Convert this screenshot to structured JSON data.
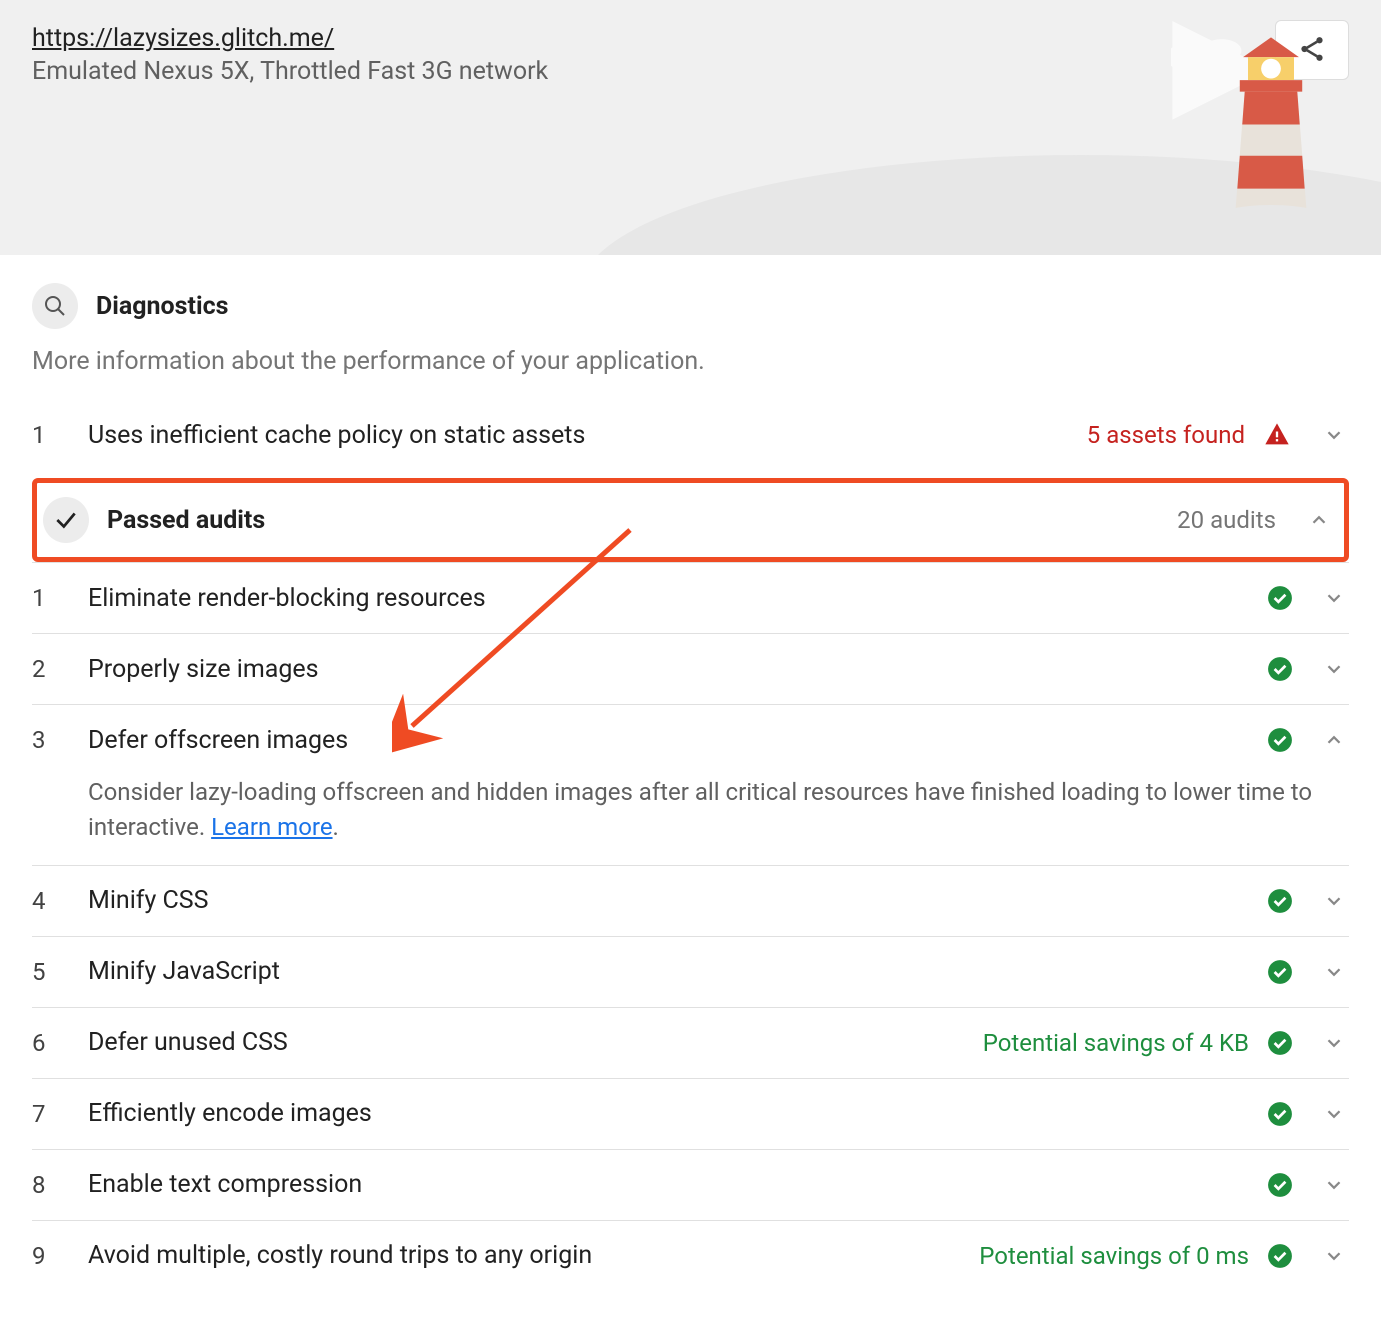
{
  "header": {
    "url": "https://lazysizes.glitch.me/",
    "subtitle": "Emulated Nexus 5X, Throttled Fast 3G network"
  },
  "diagnostics": {
    "title": "Diagnostics",
    "description": "More information about the performance of your application.",
    "items": [
      {
        "num": "1",
        "title": "Uses inefficient cache policy on static assets",
        "note": "5 assets found",
        "note_class": "red",
        "status": "warn",
        "expanded": false
      }
    ]
  },
  "passed": {
    "title": "Passed audits",
    "count": "20 audits",
    "items": [
      {
        "num": "1",
        "title": "Eliminate render-blocking resources",
        "note": "",
        "expanded": false
      },
      {
        "num": "2",
        "title": "Properly size images",
        "note": "",
        "expanded": false
      },
      {
        "num": "3",
        "title": "Defer offscreen images",
        "note": "",
        "expanded": true,
        "desc": "Consider lazy-loading offscreen and hidden images after all critical resources have finished loading to lower time to interactive. ",
        "learn_more": "Learn more"
      },
      {
        "num": "4",
        "title": "Minify CSS",
        "note": "",
        "expanded": false
      },
      {
        "num": "5",
        "title": "Minify JavaScript",
        "note": "",
        "expanded": false
      },
      {
        "num": "6",
        "title": "Defer unused CSS",
        "note": "Potential savings of 4 KB",
        "expanded": false
      },
      {
        "num": "7",
        "title": "Efficiently encode images",
        "note": "",
        "expanded": false
      },
      {
        "num": "8",
        "title": "Enable text compression",
        "note": "",
        "expanded": false
      },
      {
        "num": "9",
        "title": "Avoid multiple, costly round trips to any origin",
        "note": "Potential savings of 0 ms",
        "expanded": false
      }
    ]
  }
}
